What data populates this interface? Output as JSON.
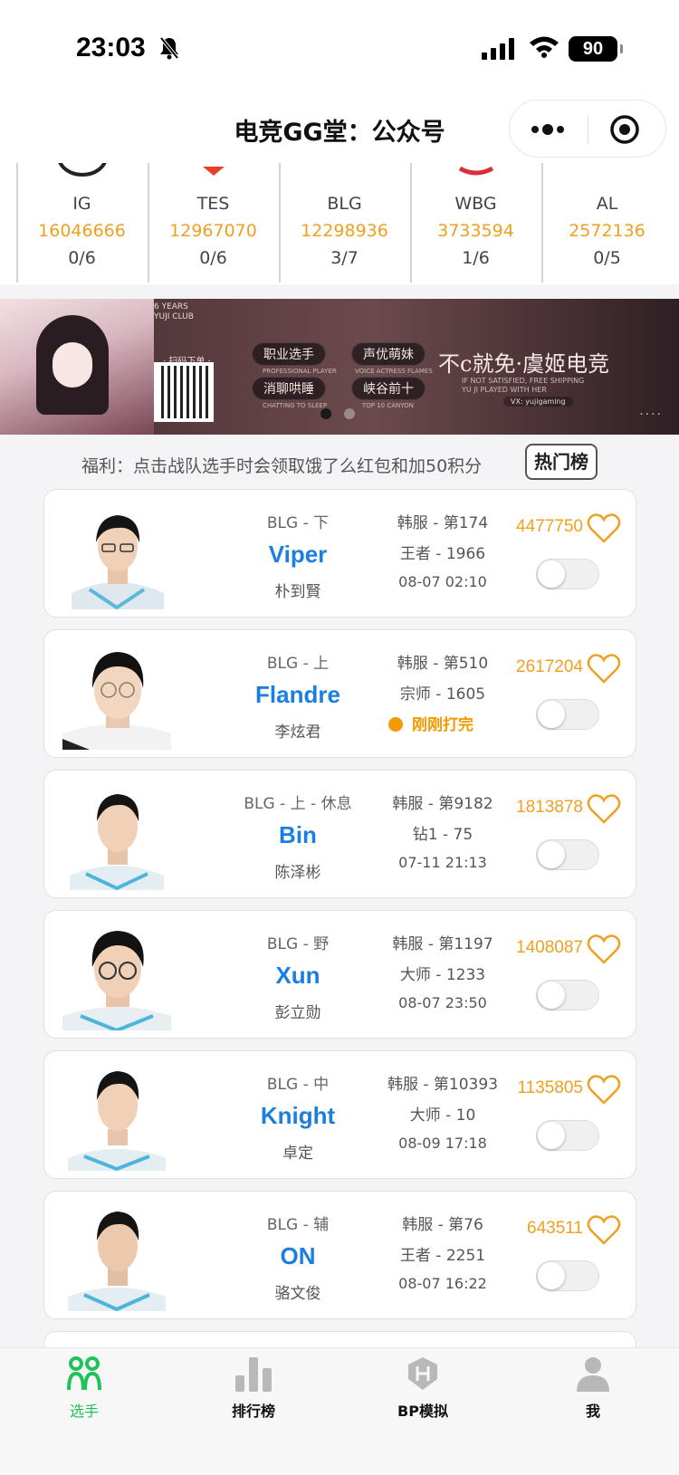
{
  "status_bar": {
    "time": "23:03",
    "battery": "90"
  },
  "nav": {
    "title": "电竞GG堂：公众号"
  },
  "teams": [
    {
      "name": "IG",
      "popularity": "16046666",
      "record": "0/6",
      "logo_color": "#222222"
    },
    {
      "name": "TES",
      "popularity": "12967070",
      "record": "0/6",
      "logo_color": "#e8402c"
    },
    {
      "name": "BLG",
      "popularity": "12298936",
      "record": "3/7",
      "logo_color": "#222222"
    },
    {
      "name": "WBG",
      "popularity": "3733594",
      "record": "1/6",
      "logo_color": "#d8303a"
    },
    {
      "name": "AL",
      "popularity": "2572136",
      "record": "0/5",
      "logo_color": "#222222"
    }
  ],
  "banner": {
    "years_text": "6 YEARS\nYUJI CLUB",
    "scan_text": "· 扫码下单 ·",
    "pills": [
      "职业选手",
      "声优萌妹",
      "消聊哄睡",
      "峡谷前十"
    ],
    "pill_subs": [
      "PROFESSIONAL PLAYER",
      "VOICE ACTRESS FLAMES",
      "CHATTING TO SLEEP",
      "TOP 10 CANYON"
    ],
    "slogan": "不c就免·虞姬电竞",
    "slogan_sub": "IF NOT SATISFIED, FREE SHIPPING\nYU JI PLAYED WITH HER",
    "wechat": "VX: yujigaming"
  },
  "promo": {
    "text": "福利：点击战队选手时会领取饿了么红包和加50积分",
    "hot_button": "热门榜"
  },
  "players": [
    {
      "team_pos": "BLG - 下",
      "name": "Viper",
      "name_cn": "朴到賢",
      "server_rank": "韩服 - 第174",
      "tier": "王者 - 1966",
      "last_played": "08-07 02:10",
      "live": false,
      "score": "4477750"
    },
    {
      "team_pos": "BLG - 上",
      "name": "Flandre",
      "name_cn": "李炫君",
      "server_rank": "韩服 - 第510",
      "tier": "宗师 - 1605",
      "last_played": "刚刚打完",
      "live": true,
      "score": "2617204"
    },
    {
      "team_pos": "BLG - 上 - 休息",
      "name": "Bin",
      "name_cn": "陈泽彬",
      "server_rank": "韩服 - 第9182",
      "tier": "钻1 - 75",
      "last_played": "07-11 21:13",
      "live": false,
      "score": "1813878"
    },
    {
      "team_pos": "BLG - 野",
      "name": "Xun",
      "name_cn": "彭立勋",
      "server_rank": "韩服 - 第1197",
      "tier": "大师 - 1233",
      "last_played": "08-07 23:50",
      "live": false,
      "score": "1408087"
    },
    {
      "team_pos": "BLG - 中",
      "name": "Knight",
      "name_cn": "卓定",
      "server_rank": "韩服 - 第10393",
      "tier": "大师 - 10",
      "last_played": "08-09 17:18",
      "live": false,
      "score": "1135805"
    },
    {
      "team_pos": "BLG - 辅",
      "name": "ON",
      "name_cn": "骆文俊",
      "server_rank": "韩服 - 第76",
      "tier": "王者 - 2251",
      "last_played": "08-07 16:22",
      "live": false,
      "score": "643511"
    }
  ],
  "tabs": [
    {
      "label": "选手",
      "icon": "players-icon",
      "active": true
    },
    {
      "label": "排行榜",
      "icon": "leaderboard-icon",
      "active": false
    },
    {
      "label": "BP模拟",
      "icon": "bp-sim-icon",
      "active": false
    },
    {
      "label": "我",
      "icon": "profile-icon",
      "active": false
    }
  ],
  "colors": {
    "accent_orange": "#f0a020",
    "name_blue": "#1a7fe0",
    "active_green": "#1fc35a"
  }
}
